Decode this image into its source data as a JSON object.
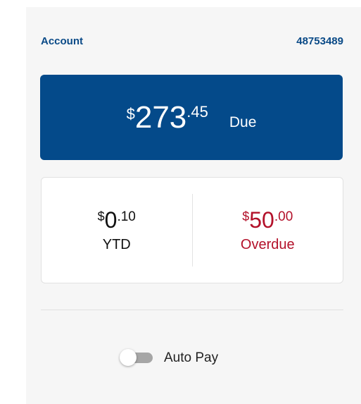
{
  "account": {
    "label": "Account",
    "number": "48753489"
  },
  "due": {
    "currency": "$",
    "whole": "273",
    "fraction": ".45",
    "label": "Due"
  },
  "stats": {
    "ytd": {
      "currency": "$",
      "whole": "0",
      "fraction": ".10",
      "label": "YTD"
    },
    "overdue": {
      "currency": "$",
      "whole": "50",
      "fraction": ".00",
      "label": "Overdue"
    }
  },
  "autopay": {
    "label": "Auto Pay",
    "enabled": false
  },
  "colors": {
    "brand_blue": "#044a8a",
    "link_blue": "#0a4a87",
    "overdue_red": "#b3112a",
    "panel_bg": "#f6f6f6"
  }
}
